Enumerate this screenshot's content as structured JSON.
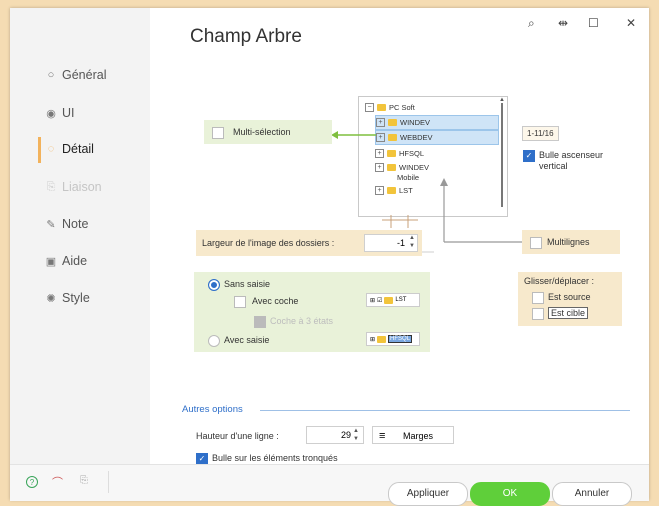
{
  "window": {
    "title": "Champ Arbre",
    "controls": [
      "⌕",
      "⇹",
      "☐",
      "✕"
    ]
  },
  "sidebar": {
    "items": [
      {
        "label": "Général",
        "icon": "○"
      },
      {
        "label": "UI",
        "icon": "◉"
      },
      {
        "label": "Détail",
        "icon": "◌"
      },
      {
        "label": "Liaison",
        "icon": "⎘"
      },
      {
        "label": "Note",
        "icon": "✎"
      },
      {
        "label": "Aide",
        "icon": "▣"
      },
      {
        "label": "Style",
        "icon": "✺"
      }
    ]
  },
  "tree": {
    "root": "PC Soft",
    "nodes": [
      "WINDEV",
      "WEBDEV",
      "HFSQL",
      "WINDEV",
      "Mobile",
      "LST"
    ]
  },
  "detail": {
    "multi_selection": "Multi-sélection",
    "scrollbar_value": "1-11/16",
    "bulle_ascenseur": "Bulle ascenseur vertical",
    "multilignes": "Multilignes",
    "largeur_label": "Largeur de l'image des dossiers :",
    "largeur_value": "-1",
    "sans_saisie": "Sans saisie",
    "avec_coche": "Avec coche",
    "coche_3_etats": "Coche à 3 états",
    "avec_saisie": "Avec saisie",
    "preview_lst": "LST",
    "preview_hfsql": "HFSQL",
    "glisser_title": "Glisser/déplacer :",
    "est_source": "Est source",
    "est_cible": "Est cible"
  },
  "autres": {
    "title": "Autres options",
    "hauteur_label": "Hauteur d'une ligne :",
    "hauteur_value": "29",
    "marges": "Marges",
    "bulle_tronques": "Bulle sur les éléments tronqués"
  },
  "footer": {
    "appliquer": "Appliquer",
    "ok": "OK",
    "annuler": "Annuler"
  },
  "colors": {
    "accent_green": "#5fcf3a",
    "selection_blue": "#cfe4f7",
    "panel_green": "#e9f2d9",
    "panel_tan": "#f7e9cc",
    "active_marker": "#f2b25c"
  }
}
